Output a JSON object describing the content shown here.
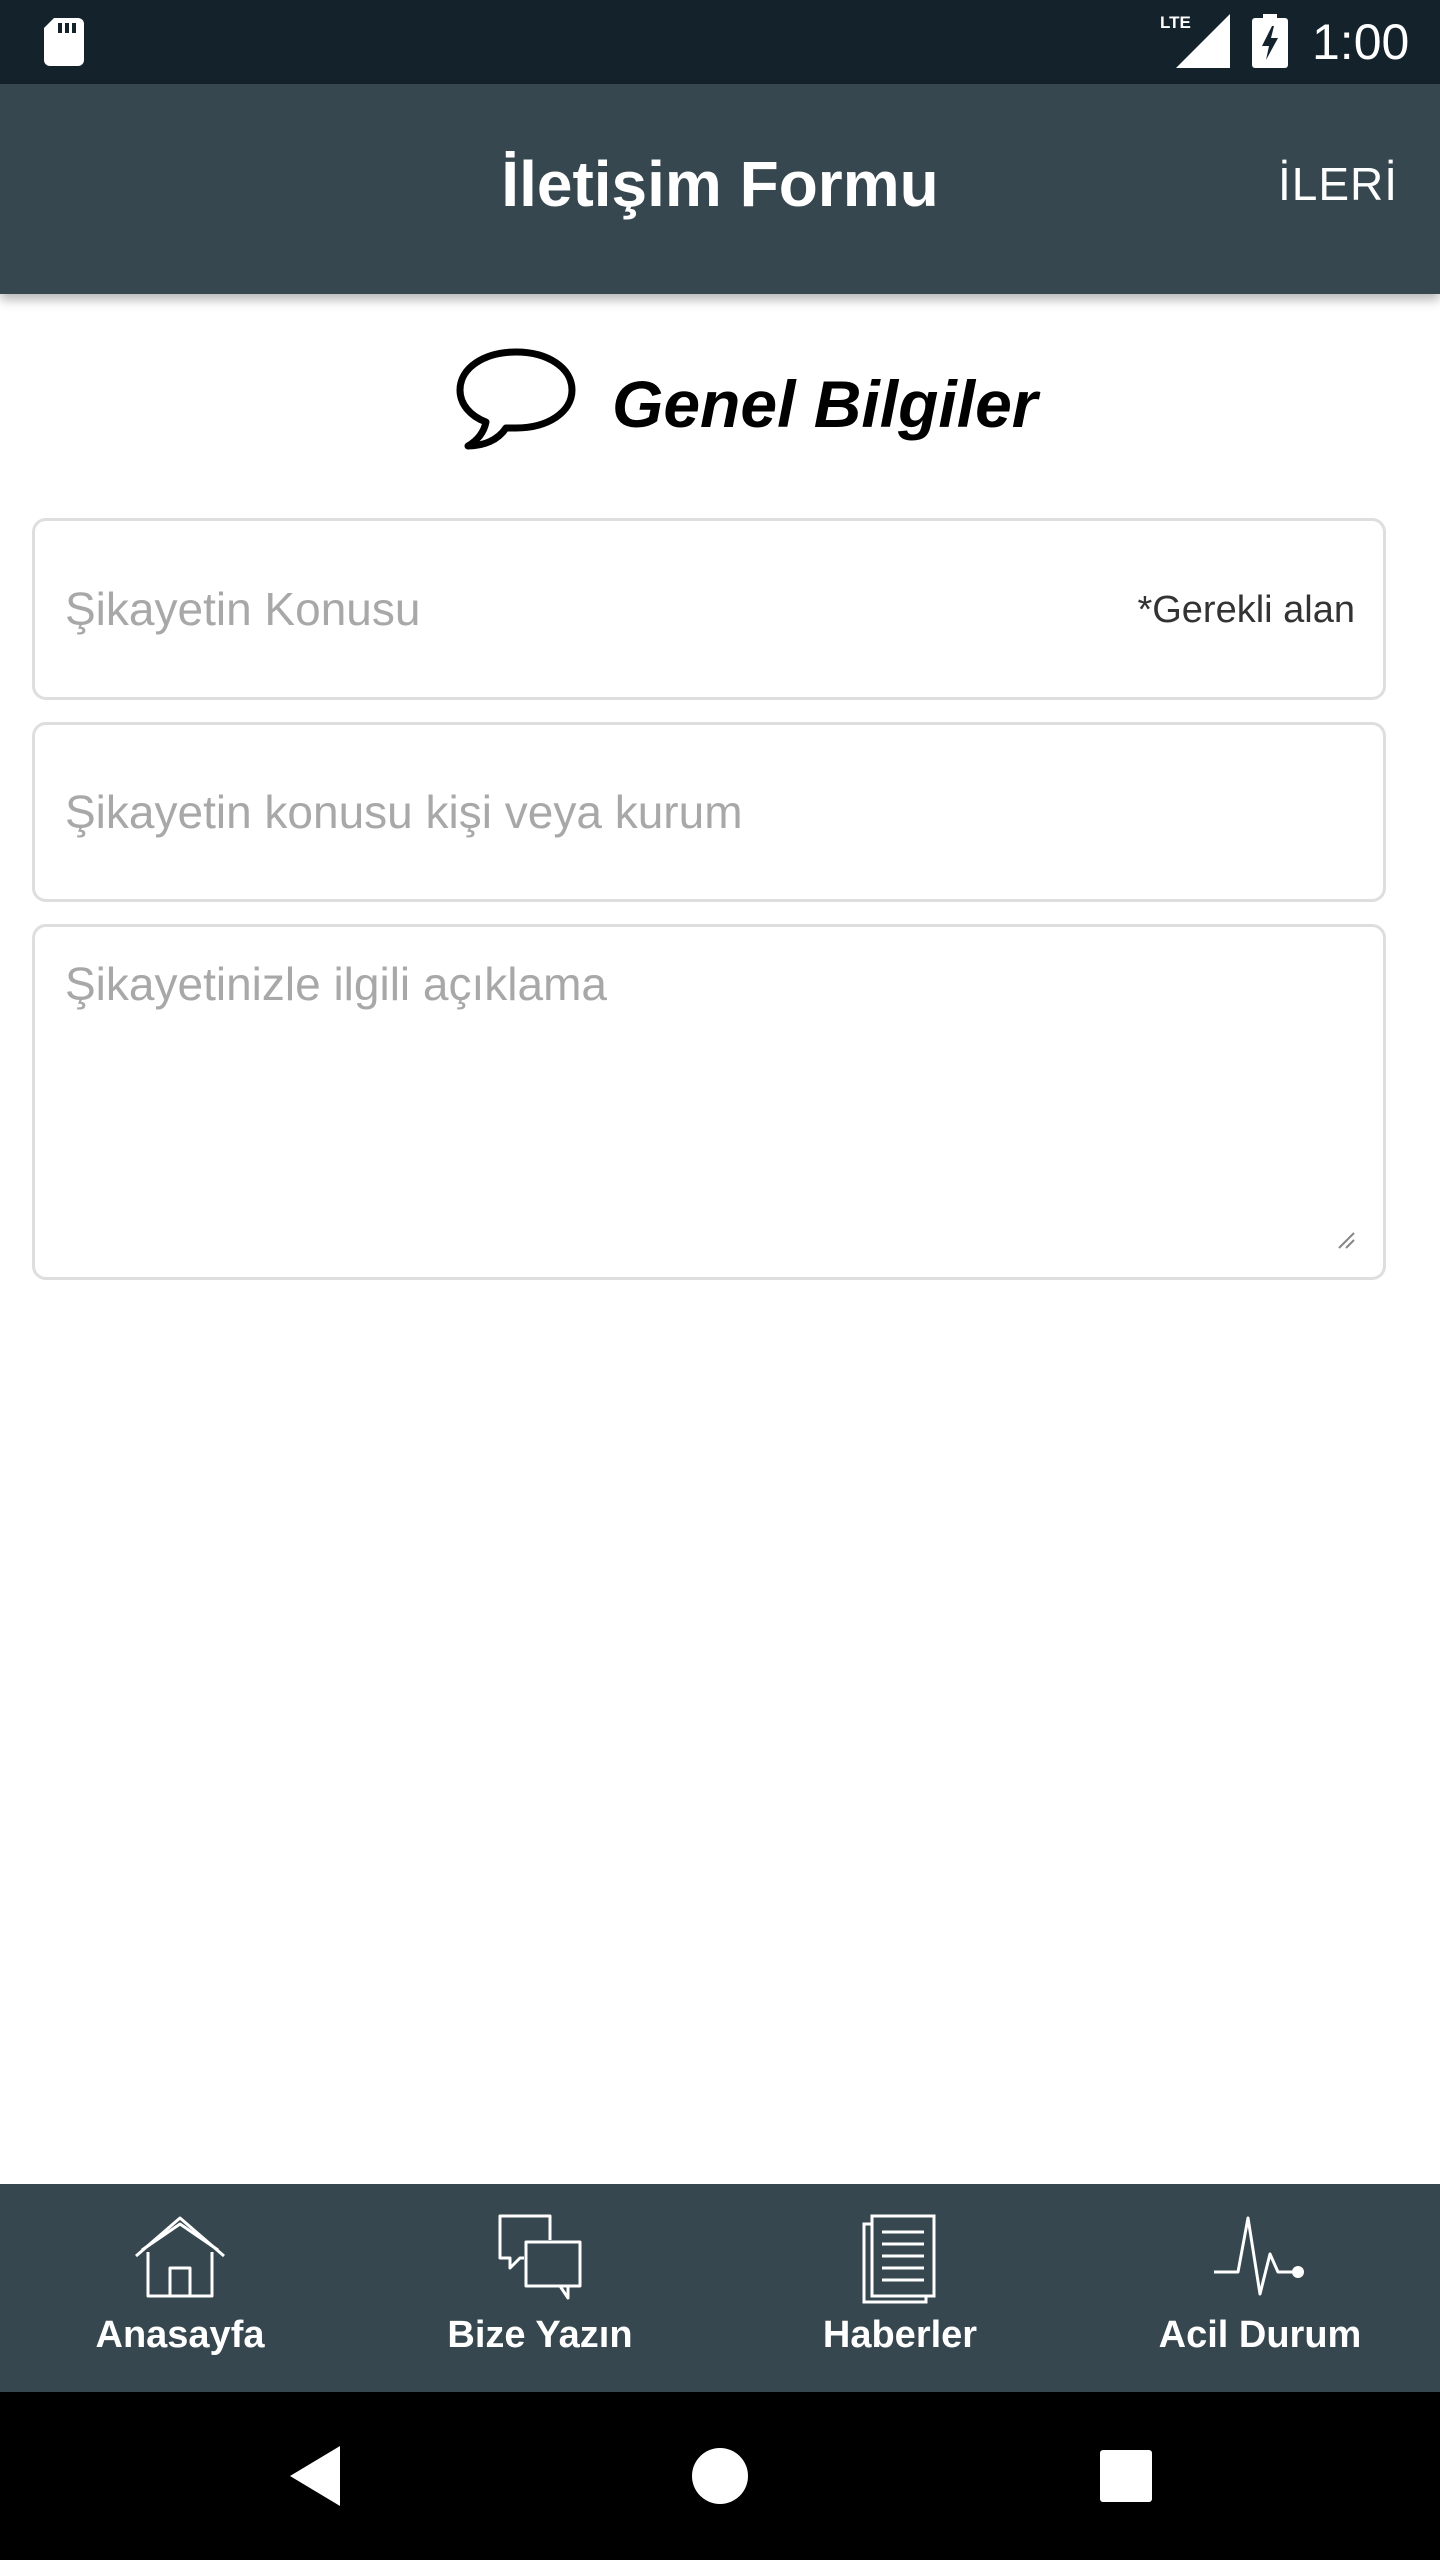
{
  "status_bar": {
    "time": "1:00",
    "network_label": "LTE",
    "icons": [
      "sd-card-icon",
      "lte-signal-icon",
      "battery-charging-icon"
    ]
  },
  "app_bar": {
    "title": "İletişim Formu",
    "next_label": "İLERİ"
  },
  "section": {
    "title": "Genel Bilgiler",
    "icon": "speech-bubble-icon"
  },
  "form": {
    "subject": {
      "placeholder": "Şikayetin Konusu",
      "value": "",
      "required_note": "*Gerekli alan"
    },
    "target": {
      "placeholder": "Şikayetin konusu kişi veya kurum",
      "value": ""
    },
    "description": {
      "placeholder": "Şikayetinizle ilgili açıklama",
      "value": ""
    }
  },
  "bottom_nav": {
    "items": [
      {
        "label": "Anasayfa",
        "icon": "home-icon"
      },
      {
        "label": "Bize Yazın",
        "icon": "chat-bubbles-icon"
      },
      {
        "label": "Haberler",
        "icon": "news-icon"
      },
      {
        "label": "Acil Durum",
        "icon": "heartbeat-icon"
      }
    ]
  },
  "colors": {
    "status_bar": "#14232b",
    "app_bar": "#36474f",
    "field_border": "#dedede",
    "placeholder": "#a8a8a8"
  }
}
